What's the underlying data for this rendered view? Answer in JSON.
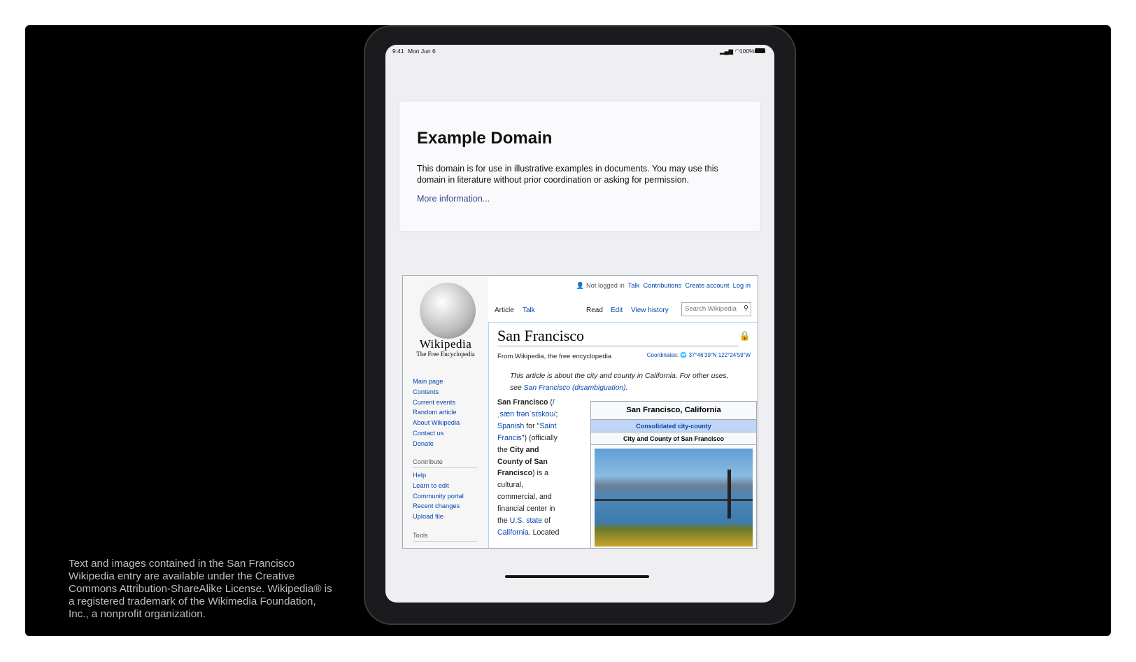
{
  "caption": "Text and images contained in the San Francisco Wikipedia entry are available under the Creative Commons Attribution-ShareAlike License. Wikipedia® is a registered trademark of the Wikimedia Foundation, Inc., a nonprofit organization.",
  "status": {
    "time": "9:41",
    "date": "Mon Jun 6",
    "battery": "100%"
  },
  "example": {
    "title": "Example Domain",
    "body": "This domain is for use in illustrative examples in documents. You may use this domain in literature without prior coordination or asking for permission.",
    "link": "More information..."
  },
  "wiki": {
    "logo_name": "Wikipedia",
    "logo_tagline": "The Free Encyclopedia",
    "user": {
      "status": "Not logged in",
      "talk": "Talk",
      "contributions": "Contributions",
      "create": "Create account",
      "login": "Log in"
    },
    "tabs": {
      "article": "Article",
      "talk": "Talk",
      "read": "Read",
      "edit": "Edit",
      "history": "View history"
    },
    "search_placeholder": "Search Wikipedia",
    "nav": [
      "Main page",
      "Contents",
      "Current events",
      "Random article",
      "About Wikipedia",
      "Contact us",
      "Donate"
    ],
    "contribute_heading": "Contribute",
    "contribute": [
      "Help",
      "Learn to edit",
      "Community portal",
      "Recent changes",
      "Upload file"
    ],
    "tools_heading": "Tools",
    "title": "San Francisco",
    "from": "From Wikipedia, the free encyclopedia",
    "coord_label": "Coordinates:",
    "coords": "37°46′39″N 122°24′59″W",
    "hatnote": "This article is about the city and county in California. For other uses, see ",
    "hatnote_link": "San Francisco (disambiguation)",
    "lead": {
      "name": "San Francisco",
      "ipa": "/ˌsæn frənˈsɪskoʊ/",
      "spanish": "Spanish",
      "for": " for \"",
      "saint": "Saint Francis",
      "officially": "\") (officially the ",
      "official": "City and County of San Francisco",
      "rest1": ") is a cultural, commercial, and financial center in the ",
      "us": "U.S. state",
      "of": " of ",
      "ca": "California",
      "rest2": ". Located"
    },
    "infobox": {
      "title": "San Francisco, California",
      "type": "Consolidated city-county",
      "official": "City and County of San Francisco"
    }
  }
}
